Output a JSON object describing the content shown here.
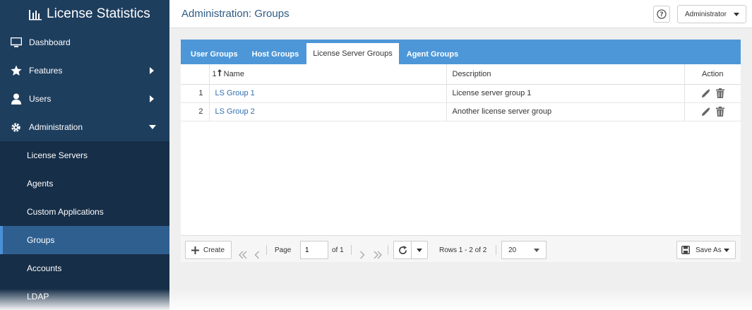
{
  "app": {
    "title": "License Statistics"
  },
  "colors": {
    "sidebar_bg": "#1e3e5e",
    "accent": "#4d97d8",
    "active_item": "#2f5f8f",
    "link": "#2f6fb0"
  },
  "sidebar": {
    "items": [
      {
        "label": "Dashboard",
        "icon": "monitor-icon"
      },
      {
        "label": "Features",
        "icon": "star-icon"
      },
      {
        "label": "Users",
        "icon": "user-icon"
      },
      {
        "label": "Administration",
        "icon": "gear-icon"
      }
    ],
    "admin_sub": [
      {
        "label": "License Servers"
      },
      {
        "label": "Agents"
      },
      {
        "label": "Custom Applications"
      },
      {
        "label": "Groups",
        "active": true
      },
      {
        "label": "Accounts"
      },
      {
        "label": "LDAP"
      }
    ]
  },
  "header": {
    "title": "Administration: Groups",
    "user_menu": "Administrator",
    "help_icon": "help-icon"
  },
  "tabs": [
    {
      "label": "User Groups"
    },
    {
      "label": "Host Groups"
    },
    {
      "label": "License Server Groups",
      "active": true
    },
    {
      "label": "Agent Groups"
    }
  ],
  "table": {
    "sort_indicator": "1",
    "headers": {
      "name": "Name",
      "description": "Description",
      "action": "Action"
    },
    "rows": [
      {
        "num": "1",
        "name": "LS Group 1",
        "description": "License server group 1"
      },
      {
        "num": "2",
        "name": "LS Group 2",
        "description": "Another license server group"
      }
    ]
  },
  "toolbar": {
    "create_label": "Create",
    "page_label": "Page",
    "page_value": "1",
    "of_label": "of 1",
    "rows_info": "Rows 1 - 2 of 2",
    "page_size": "20",
    "save_as_label": "Save As"
  }
}
